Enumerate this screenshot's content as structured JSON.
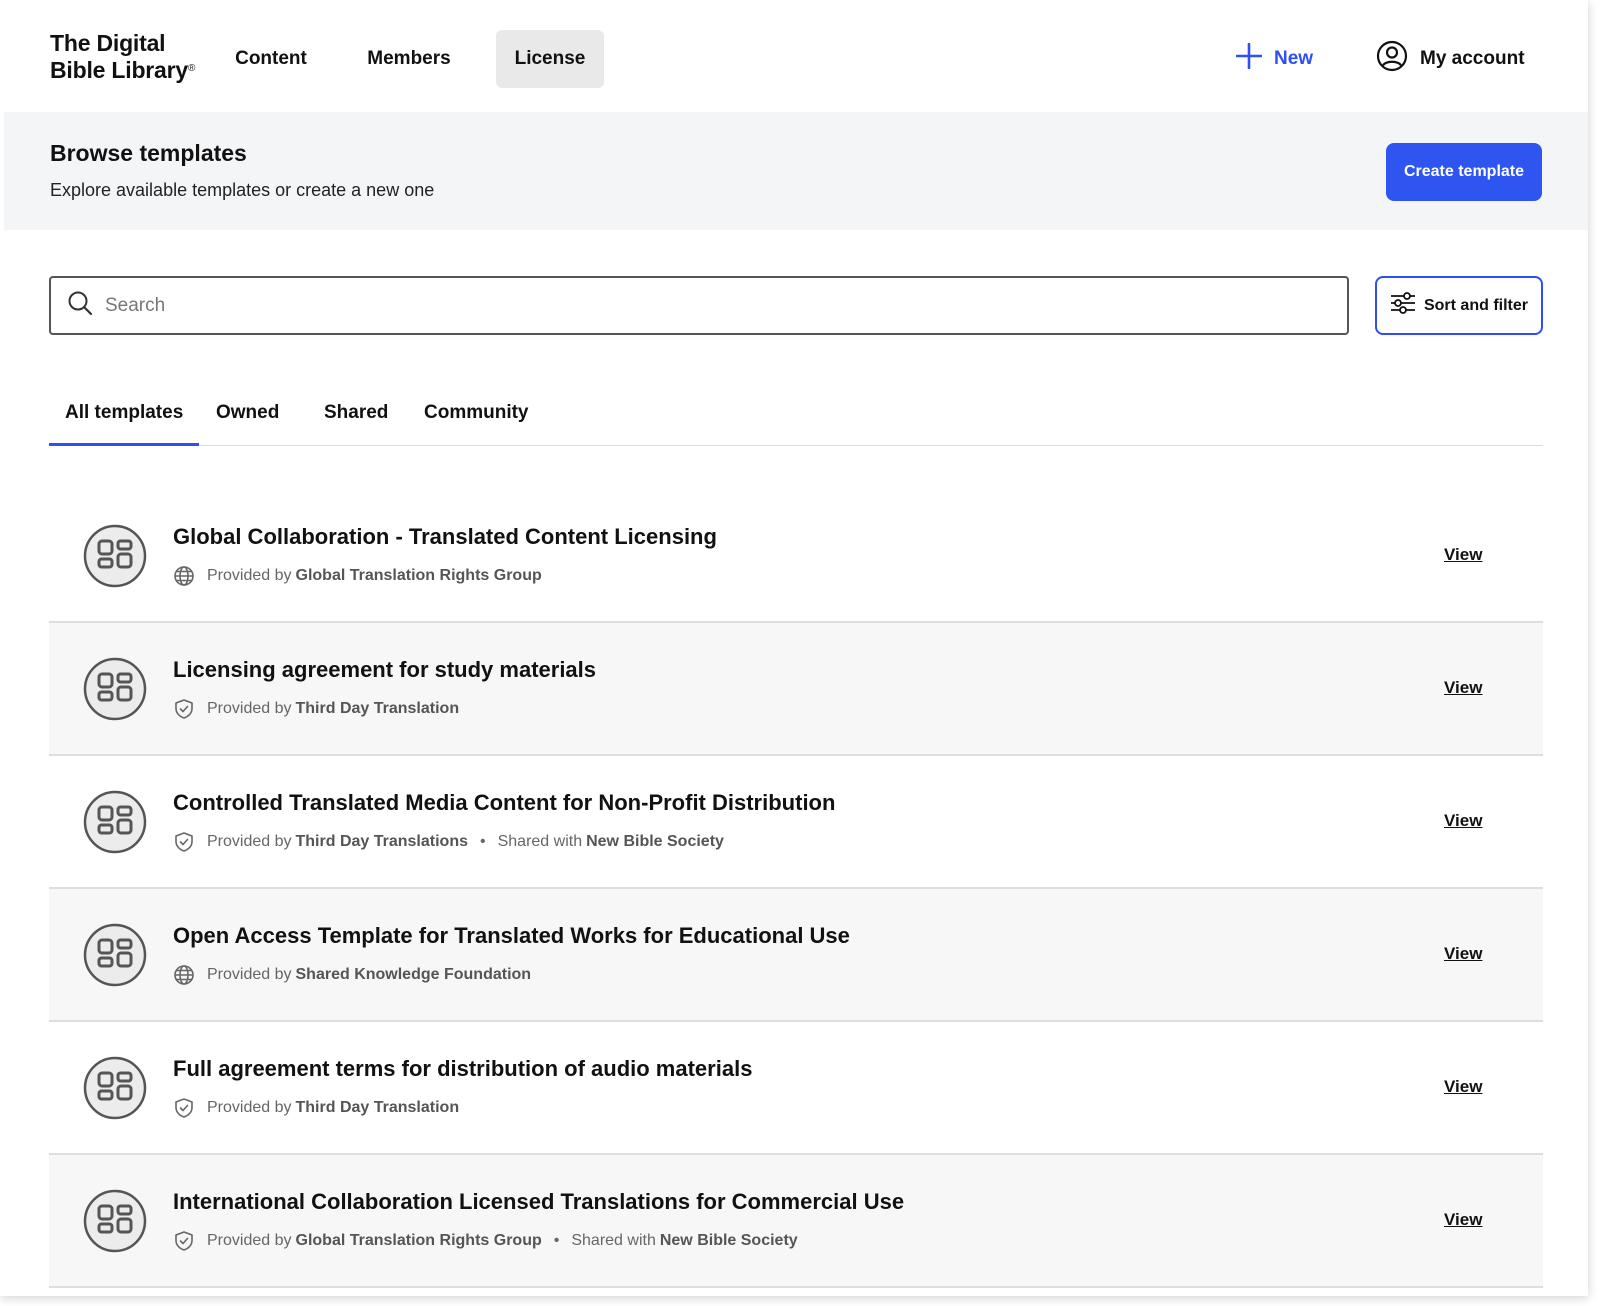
{
  "app": {
    "logo_line1": "The Digital",
    "logo_line2": "Bible Library",
    "logo_mark": "®"
  },
  "nav": {
    "items": [
      {
        "label": "Content",
        "active": false
      },
      {
        "label": "Members",
        "active": false
      },
      {
        "label": "License",
        "active": true
      }
    ],
    "new_label": "New",
    "account_label": "My account"
  },
  "header": {
    "title": "Browse templates",
    "subtitle": "Explore available templates or create a new one",
    "create_label": "Create template"
  },
  "search": {
    "placeholder": "Search",
    "value": ""
  },
  "sort_filter_label": "Sort and filter",
  "tabs": [
    {
      "label": "All templates",
      "active": true
    },
    {
      "label": "Owned",
      "active": false
    },
    {
      "label": "Shared",
      "active": false
    },
    {
      "label": "Community",
      "active": false
    }
  ],
  "templates": [
    {
      "title": "Global Collaboration - Translated Content Licensing",
      "meta_icon": "globe-icon",
      "provided_prefix": "Provided by",
      "provider": "Global Translation Rights Group",
      "shared_prefix": "",
      "shared_with": "",
      "view_label": "View"
    },
    {
      "title": "Licensing agreement for study materials",
      "meta_icon": "shield-check-icon",
      "provided_prefix": "Provided by",
      "provider": "Third Day Translation",
      "shared_prefix": "",
      "shared_with": "",
      "view_label": "View"
    },
    {
      "title": "Controlled Translated Media Content for Non-Profit Distribution",
      "meta_icon": "shield-check-icon",
      "provided_prefix": "Provided by",
      "provider": "Third Day Translations",
      "shared_prefix": "Shared with",
      "shared_with": "New Bible Society",
      "view_label": "View"
    },
    {
      "title": "Open Access Template for Translated Works for Educational Use",
      "meta_icon": "globe-icon",
      "provided_prefix": "Provided by",
      "provider": "Shared Knowledge Foundation",
      "shared_prefix": "",
      "shared_with": "",
      "view_label": "View"
    },
    {
      "title": "Full agreement terms for distribution of audio materials",
      "meta_icon": "shield-check-icon",
      "provided_prefix": "Provided by",
      "provider": "Third Day Translation",
      "shared_prefix": "",
      "shared_with": "",
      "view_label": "View"
    },
    {
      "title": "International Collaboration Licensed Translations for Commercial Use",
      "meta_icon": "shield-check-icon",
      "provided_prefix": "Provided by",
      "provider": "Global Translation Rights Group",
      "shared_prefix": "Shared with",
      "shared_with": "New Bible Society",
      "view_label": "View"
    }
  ],
  "colors": {
    "accent": "#2f4ff0",
    "primary_button": "#2f55f0",
    "band_bg": "#f4f5f7",
    "row_alt_bg": "#f7f7f7"
  }
}
